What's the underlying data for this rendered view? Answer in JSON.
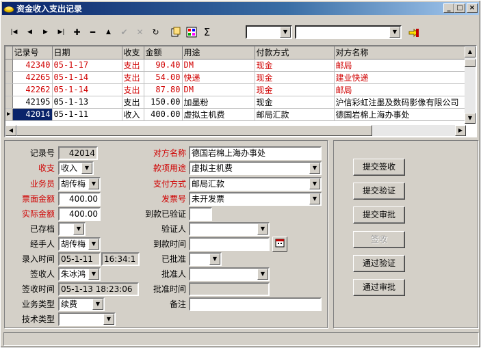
{
  "window": {
    "title": "资金收入支出记录",
    "min": "_",
    "max": "□",
    "close": "×"
  },
  "toolbar": {
    "first": "|◀",
    "prev": "◀",
    "next": "▶",
    "last": "▶|",
    "add": "✚",
    "delete": "━",
    "edit": "▲",
    "post": "✔",
    "cancel": "✕",
    "refresh": "↻",
    "sigma": "Σ"
  },
  "grid": {
    "headers": [
      "记录号",
      "日期",
      "收支",
      "金额",
      "用途",
      "付款方式",
      "对方名称"
    ],
    "rows": [
      {
        "id": "42340",
        "date": "05-1-17",
        "type": "支出",
        "amount": "90.40",
        "use": "DM",
        "pay": "现金",
        "party": "邮局",
        "red": true
      },
      {
        "id": "42265",
        "date": "05-1-14",
        "type": "支出",
        "amount": "54.00",
        "use": "快递",
        "pay": "现金",
        "party": "建业快递",
        "red": true
      },
      {
        "id": "42262",
        "date": "05-1-14",
        "type": "支出",
        "amount": "87.80",
        "use": "DM",
        "pay": "现金",
        "party": "邮局",
        "red": true
      },
      {
        "id": "42195",
        "date": "05-1-13",
        "type": "支出",
        "amount": "150.00",
        "use": "加墨粉",
        "pay": "现金",
        "party": "沪信彩虹注墨及数码影像有限公司",
        "red": false
      },
      {
        "id": "42014",
        "date": "05-1-11",
        "type": "收入",
        "amount": "400.00",
        "use": "虚拟主机费",
        "pay": "邮局汇款",
        "party": "德国岩棉上海办事处",
        "red": false
      }
    ]
  },
  "form": {
    "record_no_label": "记录号",
    "record_no": "42014",
    "inout_label": "收支",
    "inout": "收入",
    "salesman_label": "业务员",
    "salesman": "胡传梅",
    "face_amount_label": "票面金额",
    "face_amount": "400.00",
    "actual_amount_label": "实际金额",
    "actual_amount": "400.00",
    "archived_label": "已存档",
    "archived": "",
    "handler_label": "经手人",
    "handler": "胡传梅",
    "entry_time_label": "录入时间",
    "entry_date": "05-1-11",
    "entry_time": "16:34:1",
    "receiver_label": "签收人",
    "receiver": "朱冰鸿",
    "sign_time_label": "签收时间",
    "sign_time": "05-1-13 18:23:06",
    "biz_type_label": "业务类型",
    "biz_type": "续费",
    "tech_type_label": "技术类型",
    "tech_type": "",
    "party_label": "对方名称",
    "party": "德国岩棉上海办事处",
    "use_label": "款项用途",
    "use": "虚拟主机费",
    "pay_label": "支付方式",
    "pay": "邮局汇款",
    "invoice_label": "发票号",
    "invoice": "未开发票",
    "arrival_verified_label": "到款已验证",
    "arrival_verified": "",
    "verifier_label": "验证人",
    "verifier": "",
    "arrival_time_label": "到款时间",
    "arrival_time": "",
    "approved_label": "已批准",
    "approved": "",
    "approver_label": "批准人",
    "approver": "",
    "approve_time_label": "批准时间",
    "approve_time": "",
    "remark_label": "备注",
    "remark": ""
  },
  "buttons": {
    "submit_sign": "提交签收",
    "submit_verify": "提交验证",
    "submit_approve": "提交审批",
    "sign": "签收",
    "pass_verify": "通过验证",
    "pass_approve": "通过审批"
  },
  "colors": {
    "red_label": "#d00000",
    "title_bar": "#0a246a",
    "selection": "#0a246a"
  }
}
